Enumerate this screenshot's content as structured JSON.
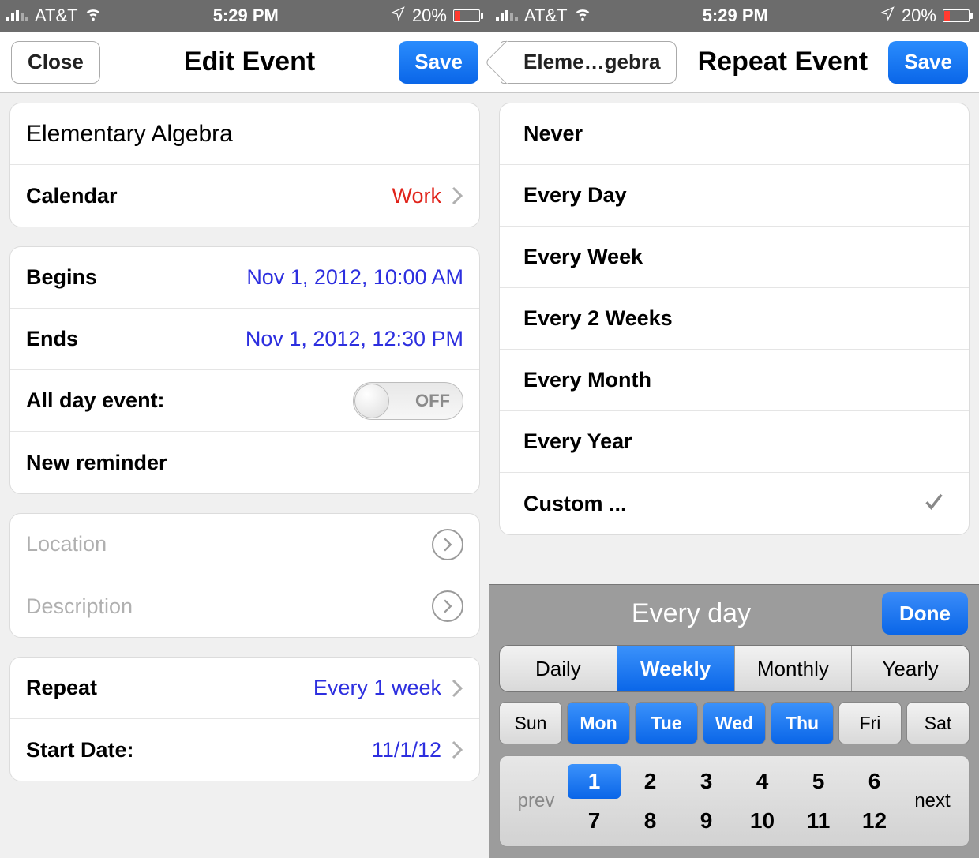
{
  "status": {
    "carrier": "AT&T",
    "time": "5:29 PM",
    "battery_pct": "20%"
  },
  "left": {
    "nav": {
      "close": "Close",
      "title": "Edit Event",
      "save": "Save"
    },
    "event_title": "Elementary Algebra",
    "calendar_label": "Calendar",
    "calendar_value": "Work",
    "begins_label": "Begins",
    "begins_value": "Nov 1, 2012, 10:00 AM",
    "ends_label": "Ends",
    "ends_value": "Nov 1, 2012, 12:30 PM",
    "allday_label": "All day event:",
    "allday_toggle": "OFF",
    "new_reminder": "New reminder",
    "location_label": "Location",
    "description_label": "Description",
    "repeat_label": "Repeat",
    "repeat_value": "Every 1 week",
    "start_date_label": "Start Date:",
    "start_date_value": "11/1/12"
  },
  "right": {
    "nav": {
      "back": "Eleme…gebra",
      "title": "Repeat Event",
      "save": "Save"
    },
    "options": [
      {
        "label": "Never",
        "checked": false
      },
      {
        "label": "Every Day",
        "checked": false
      },
      {
        "label": "Every Week",
        "checked": false
      },
      {
        "label": "Every 2 Weeks",
        "checked": false
      },
      {
        "label": "Every Month",
        "checked": false
      },
      {
        "label": "Every Year",
        "checked": false
      },
      {
        "label": "Custom ...",
        "checked": true
      }
    ],
    "picker": {
      "title": "Every day",
      "done": "Done",
      "freq": [
        {
          "label": "Daily",
          "active": false
        },
        {
          "label": "Weekly",
          "active": true
        },
        {
          "label": "Monthly",
          "active": false
        },
        {
          "label": "Yearly",
          "active": false
        }
      ],
      "days": [
        {
          "label": "Sun",
          "active": false
        },
        {
          "label": "Mon",
          "active": true
        },
        {
          "label": "Tue",
          "active": true
        },
        {
          "label": "Wed",
          "active": true
        },
        {
          "label": "Thu",
          "active": true
        },
        {
          "label": "Fri",
          "active": false
        },
        {
          "label": "Sat",
          "active": false
        }
      ],
      "prev": "prev",
      "next": "next",
      "numbers": [
        1,
        2,
        3,
        4,
        5,
        6,
        7,
        8,
        9,
        10,
        11,
        12
      ],
      "active_number": 1
    }
  }
}
